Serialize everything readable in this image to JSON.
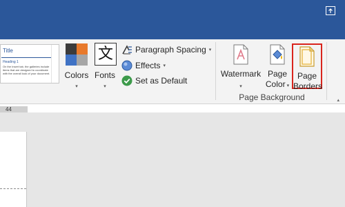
{
  "ribbon": {
    "style_gallery": {
      "title": "Title",
      "heading": "Heading 1",
      "body": "On the Insert tab, the galleries include items that are designed to coordinate with the overall look of your document."
    },
    "colors": {
      "label": "Colors",
      "swatches": [
        "#3b3b3b",
        "#e8792b",
        "#3f72c4",
        "#a6a6a6"
      ]
    },
    "fonts": {
      "label": "Fonts",
      "glyph": "文"
    },
    "paragraph_spacing": {
      "label": "Paragraph Spacing"
    },
    "effects": {
      "label": "Effects"
    },
    "set_as_default": {
      "label": "Set as Default"
    },
    "watermark": {
      "label": "Watermark"
    },
    "page_color": {
      "line1": "Page",
      "line2": "Color"
    },
    "page_borders": {
      "line1": "Page",
      "line2": "Borders"
    },
    "group_label": "Page Background"
  },
  "ruler": {
    "value": "44"
  },
  "colors": {
    "titlebar": "#2b579a",
    "highlight": "#d9241c"
  }
}
